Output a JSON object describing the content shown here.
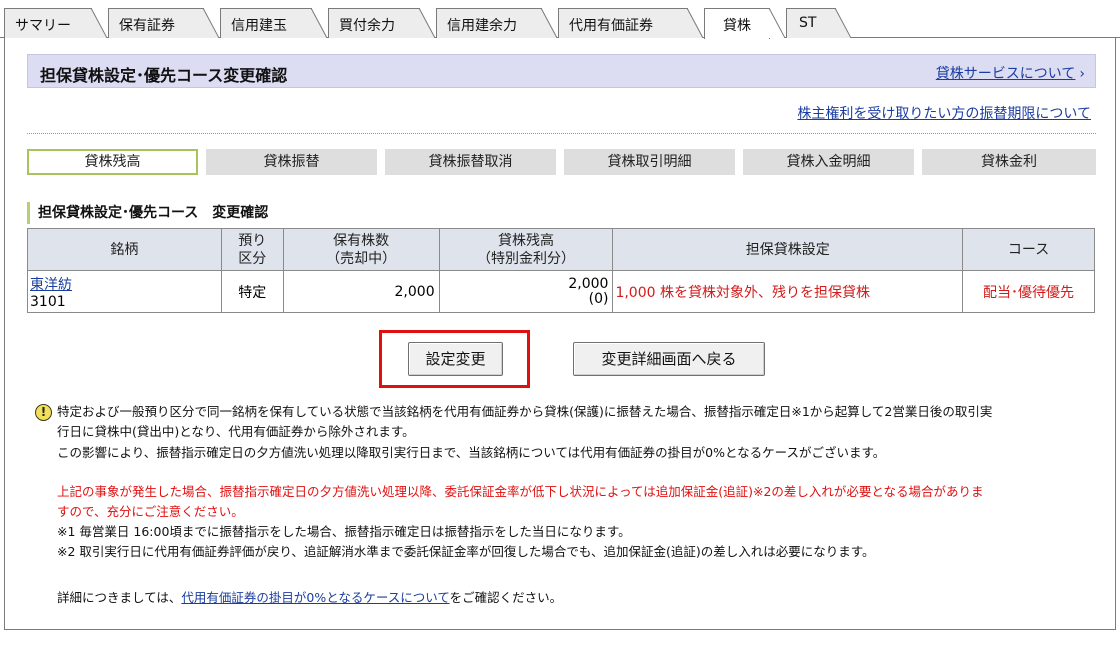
{
  "tabs": [
    {
      "label": "サマリー",
      "active": false
    },
    {
      "label": "保有証券",
      "active": false
    },
    {
      "label": "信用建玉",
      "active": false
    },
    {
      "label": "買付余力",
      "active": false
    },
    {
      "label": "信用建余力",
      "active": false
    },
    {
      "label": "代用有価証券",
      "active": false
    },
    {
      "label": "貸株",
      "active": true
    },
    {
      "label": "ST",
      "active": false
    }
  ],
  "header": {
    "title": "担保貸株設定･優先コース変更確認",
    "service_link": "貸株サービスについて",
    "rights_link": "株主権利を受け取りたい方の振替期限について"
  },
  "subtabs": [
    {
      "label": "貸株残高",
      "active": true
    },
    {
      "label": "貸株振替",
      "active": false
    },
    {
      "label": "貸株振替取消",
      "active": false
    },
    {
      "label": "貸株取引明細",
      "active": false
    },
    {
      "label": "貸株入金明細",
      "active": false
    },
    {
      "label": "貸株金利",
      "active": false
    }
  ],
  "section_title": "担保貸株設定･優先コース　変更確認",
  "table": {
    "headers": {
      "name": "銘柄",
      "account_l1": "預り",
      "account_l2": "区分",
      "holdings_l1": "保有株数",
      "holdings_l2": "（売却中）",
      "balance_l1": "貸株残高",
      "balance_l2": "（特別金利分）",
      "setting": "担保貸株設定",
      "course": "コース"
    },
    "rows": [
      {
        "name": "東洋紡",
        "code": "3101",
        "account": "特定",
        "holdings": "2,000",
        "balance": "2,000",
        "balance_special": "(0)",
        "setting": "1,000 株を貸株対象外、残りを担保貸株",
        "course": "配当･優待優先"
      }
    ]
  },
  "buttons": {
    "confirm": "設定変更",
    "back": "変更詳細画面へ戻る"
  },
  "notes": {
    "line1": "特定および一般預り区分で同一銘柄を保有している状態で当該銘柄を代用有価証券から貸株(保護)に振替えた場合、振替指示確定日※1から起算して2営業日後の取引実",
    "line2": "行日に貸株中(貸出中)となり、代用有価証券から除外されます。",
    "line3": "この影響により、振替指示確定日の夕方値洗い処理以降取引実行日まで、当該銘柄については代用有価証券の掛目が0%となるケースがございます。",
    "red1": "上記の事象が発生した場合、振替指示確定日の夕方値洗い処理以降、委託保証金率が低下し状況によっては追加保証金(追証)※2の差し入れが必要となる場合がありま",
    "red2": "すので、充分にご注意ください。",
    "fn1": "※1 毎営業日 16:00頃までに振替指示をした場合、振替指示確定日は振替指示をした当日になります。",
    "fn2": "※2 取引実行日に代用有価証券評価が戻り、追証解消水準まで委託保証金率が回復した場合でも、追加保証金(追証)の差し入れは必要になります。",
    "detail_prefix": "詳細につきましては、",
    "detail_link": "代用有価証券の掛目が0%となるケースについて",
    "detail_suffix": "をご確認ください。"
  }
}
